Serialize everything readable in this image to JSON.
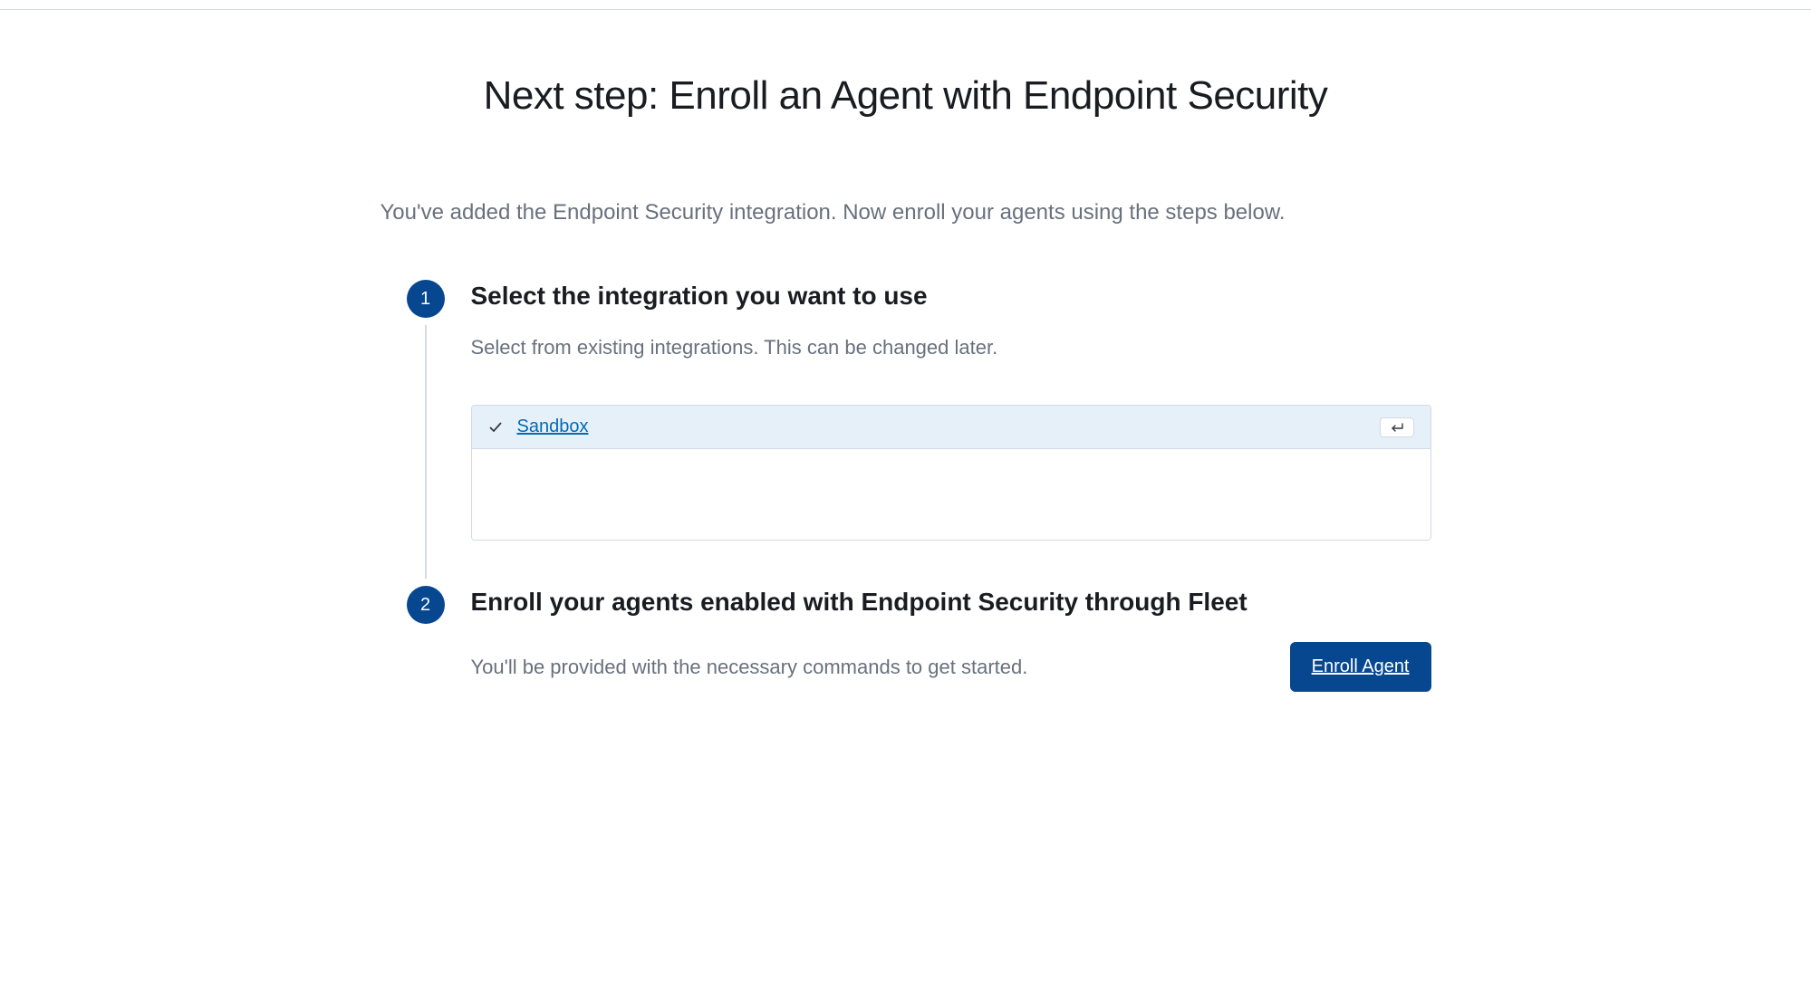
{
  "header": {
    "title": "Next step: Enroll an Agent with Endpoint Security",
    "subtitle": "You've added the Endpoint Security integration. Now enroll your agents using the steps below."
  },
  "steps": {
    "step1": {
      "number": "1",
      "title": "Select the integration you want to use",
      "description": "Select from existing integrations. This can be changed later.",
      "selected_option": "Sandbox"
    },
    "step2": {
      "number": "2",
      "title": "Enroll your agents enabled with Endpoint Security through Fleet",
      "description": "You'll be provided with the necessary commands to get started.",
      "button_label": "Enroll Agent"
    }
  }
}
